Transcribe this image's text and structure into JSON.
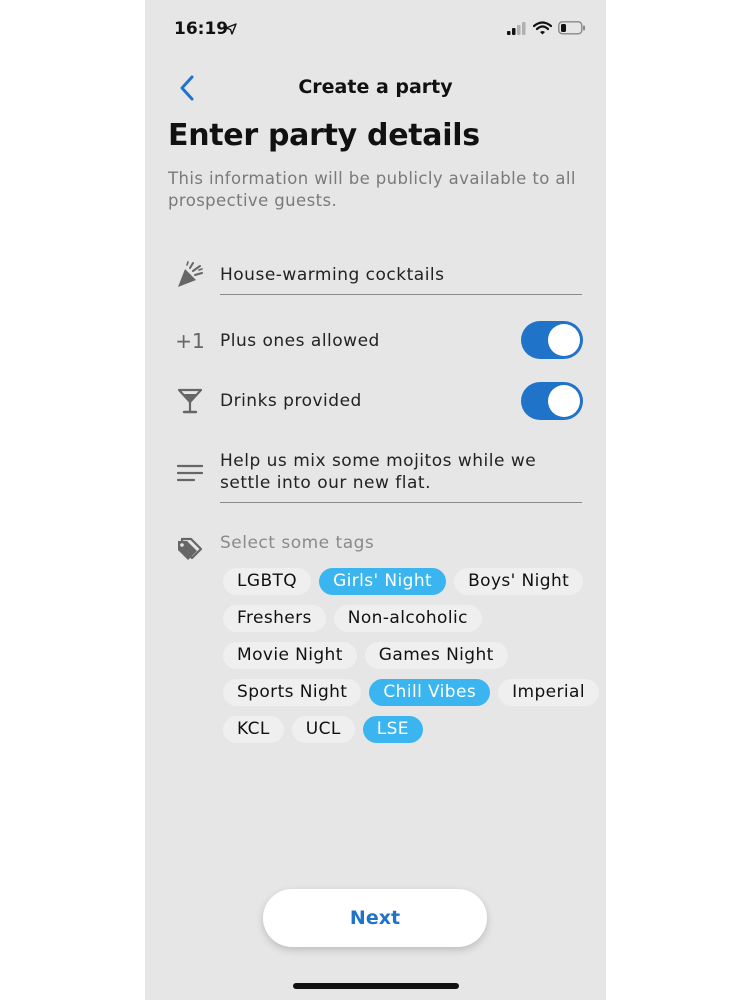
{
  "status": {
    "time": "16:19"
  },
  "nav": {
    "title": "Create a party"
  },
  "page": {
    "title": "Enter party details",
    "subtitle": "This information will be publicly available to all prospective guests."
  },
  "form": {
    "party_name": "House-warming cocktails",
    "plus_ones": {
      "icon_text": "+1",
      "label": "Plus ones allowed",
      "enabled": true
    },
    "drinks": {
      "label": "Drinks provided",
      "enabled": true
    },
    "description": "Help us mix some mojitos while we settle into our new flat.",
    "tags_label": "Select some tags",
    "tags": [
      {
        "label": "LGBTQ",
        "selected": false
      },
      {
        "label": "Girls' Night",
        "selected": true
      },
      {
        "label": "Boys' Night",
        "selected": false
      },
      {
        "label": "Freshers",
        "selected": false
      },
      {
        "label": "Non-alcoholic",
        "selected": false
      },
      {
        "label": "Movie Night",
        "selected": false
      },
      {
        "label": "Games Night",
        "selected": false
      },
      {
        "label": "Sports Night",
        "selected": false
      },
      {
        "label": "Chill Vibes",
        "selected": true
      },
      {
        "label": "Imperial",
        "selected": false
      },
      {
        "label": "KCL",
        "selected": false
      },
      {
        "label": "UCL",
        "selected": false
      },
      {
        "label": "LSE",
        "selected": true
      }
    ]
  },
  "actions": {
    "next_label": "Next"
  },
  "colors": {
    "accent": "#1f73c9",
    "tag_selected": "#3bb5ef",
    "background": "#e6e6e6"
  }
}
